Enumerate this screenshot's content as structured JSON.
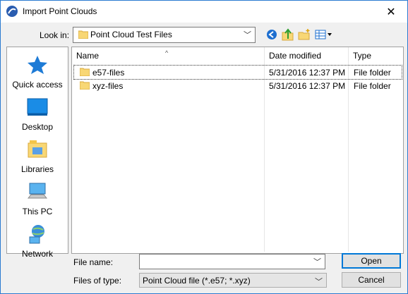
{
  "window": {
    "title": "Import Point Clouds",
    "close_glyph": "✕"
  },
  "toolbar": {
    "look_in_label": "Look in:",
    "look_in_value": "Point Cloud Test Files",
    "buttons": [
      "back-icon",
      "up-folder-icon",
      "new-folder-icon",
      "view-menu-icon"
    ]
  },
  "places": [
    {
      "label": "Quick access",
      "icon": "star-icon"
    },
    {
      "label": "Desktop",
      "icon": "desktop-icon"
    },
    {
      "label": "Libraries",
      "icon": "libraries-icon"
    },
    {
      "label": "This PC",
      "icon": "computer-icon"
    },
    {
      "label": "Network",
      "icon": "network-icon"
    }
  ],
  "file_list": {
    "columns": {
      "name": "Name",
      "date": "Date modified",
      "type": "Type"
    },
    "rows": [
      {
        "name": "e57-files",
        "date": "5/31/2016 12:37 PM",
        "type": "File folder"
      },
      {
        "name": "xyz-files",
        "date": "5/31/2016 12:37 PM",
        "type": "File folder"
      }
    ]
  },
  "footer": {
    "file_name_label": "File name:",
    "file_name_value": "",
    "files_of_type_label": "Files of type:",
    "files_of_type_value": "Point Cloud file (*.e57; *.xyz)",
    "open_label": "Open",
    "cancel_label": "Cancel"
  },
  "colors": {
    "accent": "#0078d7",
    "folder": "#f8d775"
  }
}
